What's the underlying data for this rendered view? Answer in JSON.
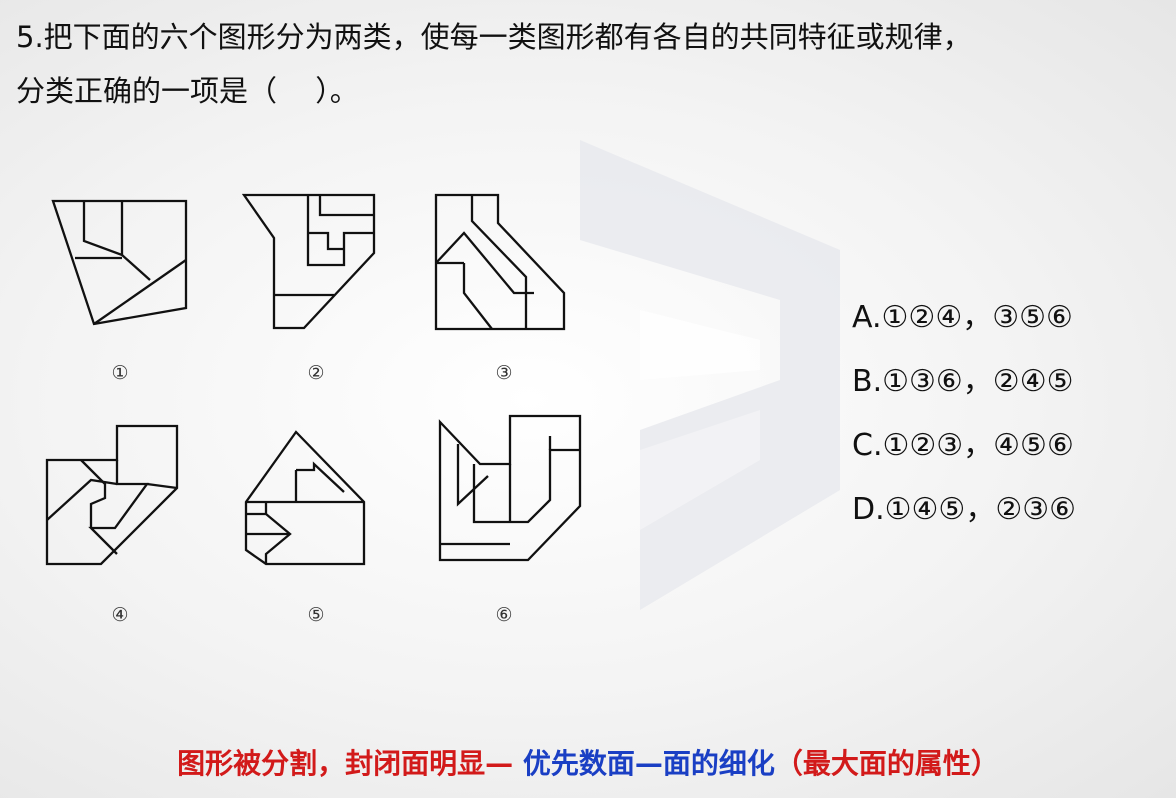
{
  "question": {
    "line1": "5.把下面的六个图形分为两类，使每一类图形都有各自的共同特征或规律，",
    "line2": "分类正确的一项是（　 ）。"
  },
  "figures": [
    {
      "label": "①"
    },
    {
      "label": "②"
    },
    {
      "label": "③"
    },
    {
      "label": "④"
    },
    {
      "label": "⑤"
    },
    {
      "label": "⑥"
    }
  ],
  "options": [
    {
      "text": "A.①②④，③⑤⑥"
    },
    {
      "text": "B.①③⑥，②④⑤"
    },
    {
      "text": "C.①②③，④⑤⑥"
    },
    {
      "text": "D.①④⑤，②③⑥"
    }
  ],
  "banner": {
    "part1": "图形被分割，封闭面明显—",
    "part2": " 优先数面—面的细化",
    "part3": "（最大面的属性）",
    "color_red": "#d21a1a",
    "color_blue": "#1a3fc4"
  }
}
